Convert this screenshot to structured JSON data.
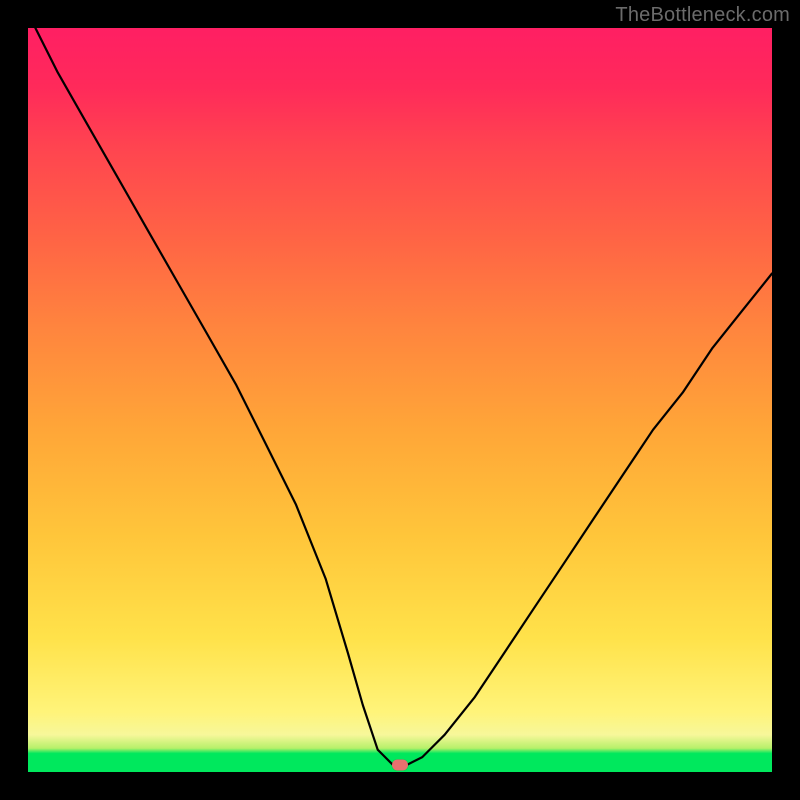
{
  "watermark": {
    "text": "TheBottleneck.com"
  },
  "chart_data": {
    "type": "line",
    "title": "",
    "xlabel": "",
    "ylabel": "",
    "xlim": [
      0,
      100
    ],
    "ylim": [
      0,
      100
    ],
    "grid": false,
    "legend": false,
    "background_gradient": {
      "direction": "vertical",
      "stops": [
        {
          "pos": 0,
          "color": "#ff1f63"
        },
        {
          "pos": 50,
          "color": "#ffb93a"
        },
        {
          "pos": 86,
          "color": "#ffe24a"
        },
        {
          "pos": 95,
          "color": "#f7f79a"
        },
        {
          "pos": 97,
          "color": "#00e85d"
        },
        {
          "pos": 100,
          "color": "#00e85d"
        }
      ]
    },
    "series": [
      {
        "name": "bottleneck-curve",
        "color": "#000000",
        "x": [
          1,
          4,
          8,
          12,
          16,
          20,
          24,
          28,
          32,
          36,
          40,
          43,
          45,
          47,
          49,
          51,
          53,
          56,
          60,
          64,
          68,
          72,
          76,
          80,
          84,
          88,
          92,
          96,
          100
        ],
        "y": [
          100,
          94,
          87,
          80,
          73,
          66,
          59,
          52,
          44,
          36,
          26,
          16,
          9,
          3,
          1,
          1,
          2,
          5,
          10,
          16,
          22,
          28,
          34,
          40,
          46,
          51,
          57,
          62,
          67
        ]
      }
    ],
    "marker": {
      "x": 50,
      "y": 1,
      "color": "#e6716f",
      "shape": "pill"
    }
  }
}
